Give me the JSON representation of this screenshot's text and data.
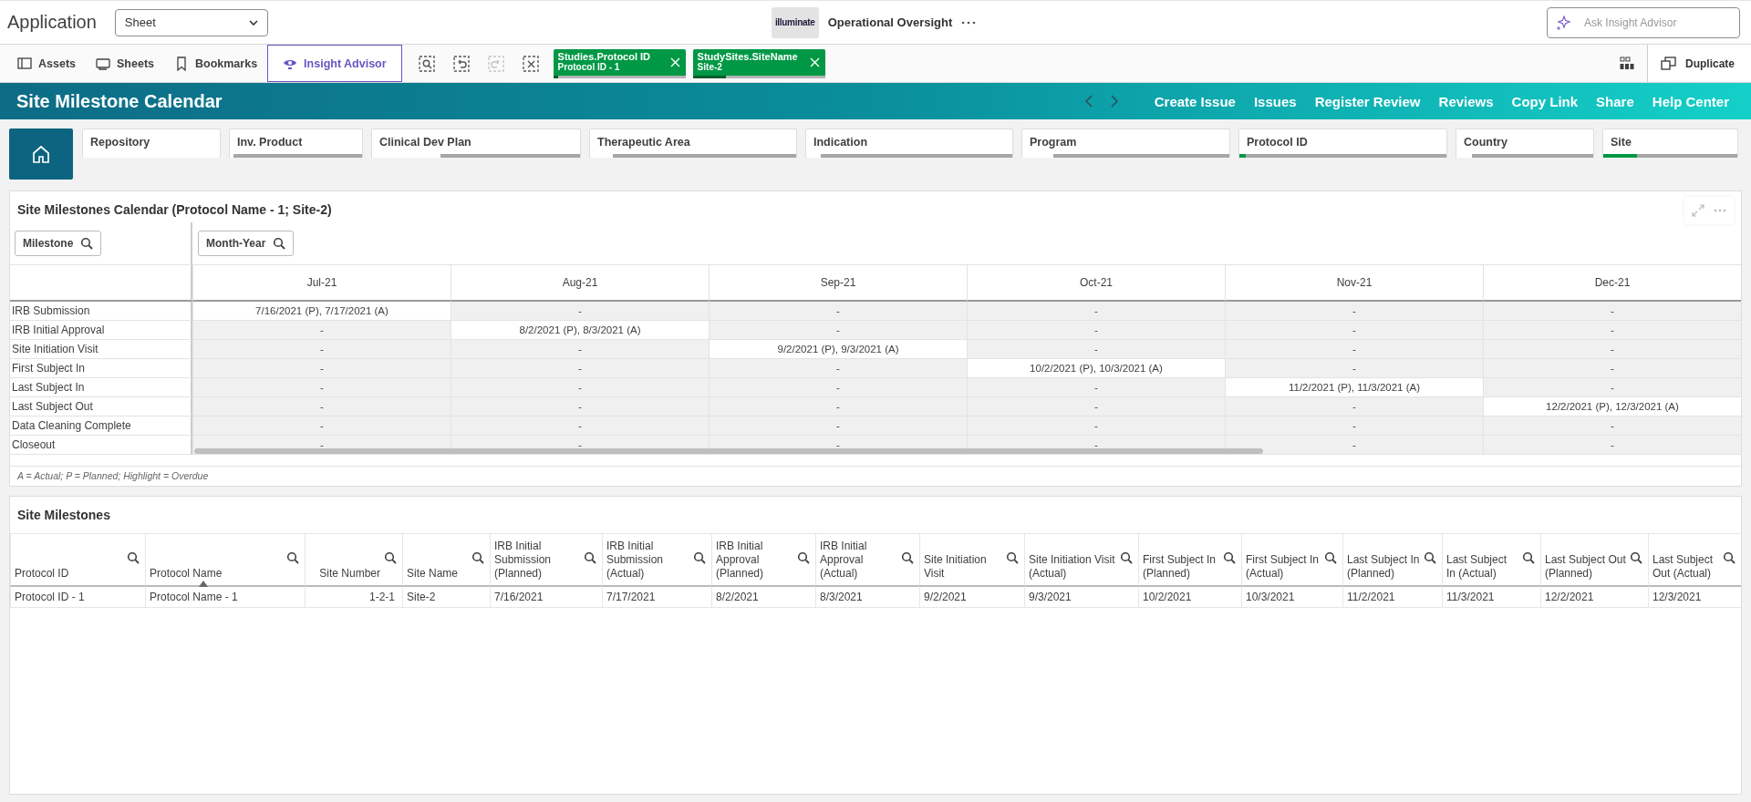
{
  "topbar": {
    "app_title": "Application",
    "sheet_dropdown": "Sheet",
    "logo_text": "illuminate",
    "app_name": "Operational Oversight",
    "search": {
      "placeholder": "Ask Insight Advisor"
    }
  },
  "toolbar": {
    "nav": [
      {
        "kind": "assets",
        "label": "Assets",
        "selected": false
      },
      {
        "kind": "sheets",
        "label": "Sheets",
        "selected": false
      },
      {
        "kind": "bookmarks",
        "label": "Bookmarks",
        "selected": false
      },
      {
        "kind": "insight",
        "label": "Insight Advisor",
        "selected": true
      }
    ],
    "tools": [
      {
        "kind": "search",
        "disabled": false
      },
      {
        "kind": "back",
        "disabled": false
      },
      {
        "kind": "forward",
        "disabled": true
      },
      {
        "kind": "clear",
        "disabled": false
      }
    ],
    "selections": [
      {
        "field": "Studies.Protocol ID",
        "value": "Protocol ID - 1",
        "level": 0.04
      },
      {
        "field": "StudySites.SiteName",
        "value": "Site-2",
        "level": 0.25
      }
    ],
    "duplicate": "Duplicate"
  },
  "header": {
    "title": "Site Milestone Calendar",
    "links": [
      "Create Issue",
      "Issues",
      "Register Review",
      "Reviews",
      "Copy Link",
      "Share",
      "Help Center"
    ]
  },
  "filters": [
    {
      "label": "Repository",
      "selected": false,
      "level": 1
    },
    {
      "label": "Inv. Product",
      "selected": false,
      "level": 0.03
    },
    {
      "label": "Clinical Dev Plan",
      "selected": false,
      "level": 0.33
    },
    {
      "label": "Therapeutic Area",
      "selected": false,
      "level": 0.11
    },
    {
      "label": "Indication",
      "selected": false,
      "level": 0.07
    },
    {
      "label": "Program",
      "selected": false,
      "level": 0.15
    },
    {
      "label": "Protocol ID",
      "selected": true,
      "level": 0.03
    },
    {
      "label": "Country",
      "selected": false,
      "level": 0.11
    },
    {
      "label": "Site",
      "selected": true,
      "level": 0.25
    }
  ],
  "calendar": {
    "title": "Site Milestones Calendar (Protocol Name - 1; Site-2)",
    "milestone_button": "Milestone",
    "month_button": "Month-Year",
    "months": [
      "Jul-21",
      "Aug-21",
      "Sep-21",
      "Oct-21",
      "Nov-21",
      "Dec-21"
    ],
    "rows": [
      {
        "milestone": "IRB Submission",
        "cells": [
          {
            "text": "7/16/2021 (P), 7/17/2021 (A)",
            "highlighted": true
          },
          {
            "text": "-",
            "highlighted": false
          },
          {
            "text": "-",
            "highlighted": false
          },
          {
            "text": "-",
            "highlighted": false
          },
          {
            "text": "-",
            "highlighted": false
          },
          {
            "text": "-",
            "highlighted": false
          }
        ]
      },
      {
        "milestone": "IRB Initial Approval",
        "cells": [
          {
            "text": "-",
            "highlighted": false
          },
          {
            "text": "8/2/2021 (P), 8/3/2021 (A)",
            "highlighted": true
          },
          {
            "text": "-",
            "highlighted": false
          },
          {
            "text": "-",
            "highlighted": false
          },
          {
            "text": "-",
            "highlighted": false
          },
          {
            "text": "-",
            "highlighted": false
          }
        ]
      },
      {
        "milestone": "Site Initiation Visit",
        "cells": [
          {
            "text": "-",
            "highlighted": false
          },
          {
            "text": "-",
            "highlighted": false
          },
          {
            "text": "9/2/2021 (P), 9/3/2021 (A)",
            "highlighted": true
          },
          {
            "text": "-",
            "highlighted": false
          },
          {
            "text": "-",
            "highlighted": false
          },
          {
            "text": "-",
            "highlighted": false
          }
        ]
      },
      {
        "milestone": "First Subject In",
        "cells": [
          {
            "text": "-",
            "highlighted": false
          },
          {
            "text": "-",
            "highlighted": false
          },
          {
            "text": "-",
            "highlighted": false
          },
          {
            "text": "10/2/2021 (P), 10/3/2021 (A)",
            "highlighted": true
          },
          {
            "text": "-",
            "highlighted": false
          },
          {
            "text": "-",
            "highlighted": false
          }
        ]
      },
      {
        "milestone": "Last Subject In",
        "cells": [
          {
            "text": "-",
            "highlighted": false
          },
          {
            "text": "-",
            "highlighted": false
          },
          {
            "text": "-",
            "highlighted": false
          },
          {
            "text": "-",
            "highlighted": false
          },
          {
            "text": "11/2/2021 (P), 11/3/2021 (A)",
            "highlighted": true
          },
          {
            "text": "-",
            "highlighted": false
          }
        ]
      },
      {
        "milestone": "Last Subject Out",
        "cells": [
          {
            "text": "-",
            "highlighted": false
          },
          {
            "text": "-",
            "highlighted": false
          },
          {
            "text": "-",
            "highlighted": false
          },
          {
            "text": "-",
            "highlighted": false
          },
          {
            "text": "-",
            "highlighted": false
          },
          {
            "text": "12/2/2021 (P), 12/3/2021 (A)",
            "highlighted": true
          }
        ]
      },
      {
        "milestone": "Data Cleaning Complete",
        "cells": [
          {
            "text": "-",
            "highlighted": false
          },
          {
            "text": "-",
            "highlighted": false
          },
          {
            "text": "-",
            "highlighted": false
          },
          {
            "text": "-",
            "highlighted": false
          },
          {
            "text": "-",
            "highlighted": false
          },
          {
            "text": "-",
            "highlighted": false
          }
        ]
      },
      {
        "milestone": "Closeout",
        "cells": [
          {
            "text": "-",
            "highlighted": false
          },
          {
            "text": "-",
            "highlighted": false
          },
          {
            "text": "-",
            "highlighted": false
          },
          {
            "text": "-",
            "highlighted": false
          },
          {
            "text": "-",
            "highlighted": false
          },
          {
            "text": "-",
            "highlighted": false
          }
        ]
      }
    ],
    "footnote": "A = Actual; P = Planned; Highlight = Overdue"
  },
  "milestones": {
    "title": "Site Milestones",
    "columns": [
      {
        "label": "Protocol ID",
        "sorted": false
      },
      {
        "label": "Protocol Name",
        "sorted": true
      },
      {
        "label": "Site Number",
        "sorted": false
      },
      {
        "label": "Site Name",
        "sorted": false
      },
      {
        "label": "IRB Initial Submission (Planned)",
        "sorted": false
      },
      {
        "label": "IRB Initial Submission (Actual)",
        "sorted": false
      },
      {
        "label": "IRB Initial Approval (Planned)",
        "sorted": false
      },
      {
        "label": "IRB Initial Approval (Actual)",
        "sorted": false
      },
      {
        "label": "Site Initiation Visit",
        "sorted": false
      },
      {
        "label": "Site Initiation Visit (Actual)",
        "sorted": false
      },
      {
        "label": "First Subject In (Planned)",
        "sorted": false
      },
      {
        "label": "First Subject In (Actual)",
        "sorted": false
      },
      {
        "label": "Last Subject In (Planned)",
        "sorted": false
      },
      {
        "label": "Last Subject In (Actual)",
        "sorted": false
      },
      {
        "label": "Last Subject Out (Planned)",
        "sorted": false
      },
      {
        "label": "Last Subject Out (Actual)",
        "sorted": false
      }
    ],
    "rows": [
      [
        "Protocol ID - 1",
        "Protocol Name - 1",
        "1-2-1",
        "Site-2",
        "7/16/2021",
        "7/17/2021",
        "8/2/2021",
        "8/3/2021",
        "9/2/2021",
        "9/3/2021",
        "10/2/2021",
        "10/3/2021",
        "11/2/2021",
        "11/3/2021",
        "12/2/2021",
        "12/3/2021"
      ]
    ]
  }
}
